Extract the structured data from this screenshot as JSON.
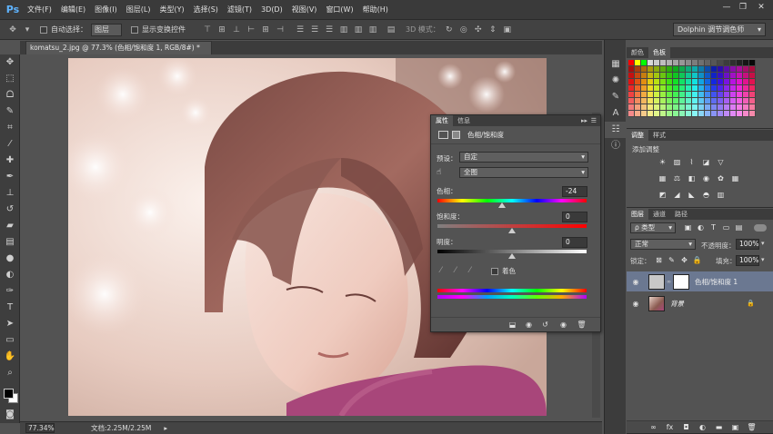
{
  "app": {
    "logo": "Ps",
    "menu": [
      "文件(F)",
      "编辑(E)",
      "图像(I)",
      "图层(L)",
      "类型(Y)",
      "选择(S)",
      "滤镜(T)",
      "3D(D)",
      "视图(V)",
      "窗口(W)",
      "帮助(H)"
    ],
    "window_controls": [
      "—",
      "❐",
      "✕"
    ]
  },
  "options_bar": {
    "auto_select_label": "自动选择：",
    "auto_select_value": "图层",
    "show_transform_label": "显示变换控件",
    "mode_3d_label": "3D 模式：",
    "workspace": "Dolphin 调节调色师"
  },
  "document": {
    "tab_title": "komatsu_2.jpg @ 77.3% (色相/饱和度 1, RGB/8#) *",
    "zoom": "77.34%",
    "doc_info": "文档:2.25M/2.25M"
  },
  "properties": {
    "tabs": [
      "属性",
      "信息"
    ],
    "panel_title": "色相/饱和度",
    "preset_label": "预设：",
    "preset_value": "自定",
    "channel_value": "全图",
    "hue_label": "色相：",
    "hue_value": "-24",
    "saturation_label": "饱和度：",
    "saturation_value": "0",
    "lightness_label": "明度：",
    "lightness_value": "0",
    "colorize_label": "着色",
    "hue_level": 0.433,
    "saturation_level": 0.5,
    "lightness_level": 0.5
  },
  "swatches_panel": {
    "tabs": [
      "颜色",
      "色板"
    ]
  },
  "adjustments_panel": {
    "tabs": [
      "调整",
      "样式"
    ],
    "title": "添加调整"
  },
  "layers_panel": {
    "tabs": [
      "图层",
      "通道",
      "路径"
    ],
    "kind_label": "ρ 类型",
    "blend_mode": "正常",
    "opacity_label": "不透明度：",
    "opacity_value": "100%",
    "lock_label": "锁定：",
    "fill_label": "填充：",
    "fill_value": "100%",
    "layers": [
      {
        "name": "色相/饱和度 1",
        "selected": true
      },
      {
        "name": "背景",
        "selected": false
      }
    ]
  }
}
